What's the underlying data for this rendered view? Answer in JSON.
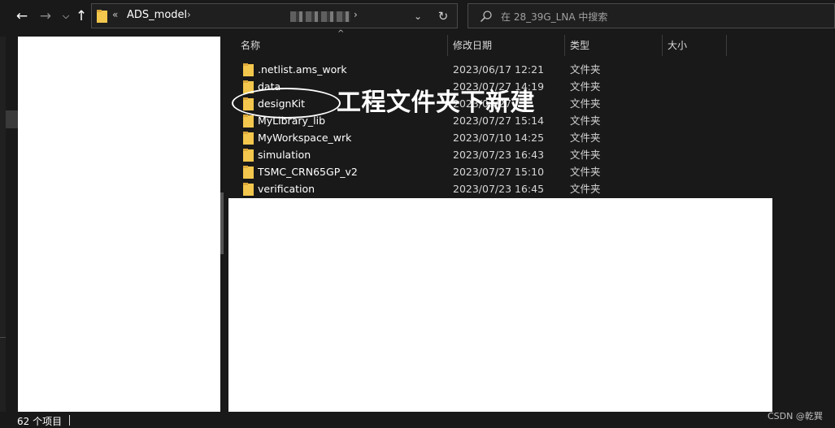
{
  "toolbar": {
    "back_icon": "back-arrow-icon",
    "forward_icon": "forward-arrow-icon",
    "recent_icon": "chevron-down-icon",
    "up_icon": "up-arrow-icon"
  },
  "address": {
    "overflow": "«",
    "crumb": "ADS_model",
    "crumb_sep": "›",
    "end_sep": "›",
    "dropdown": "⌄",
    "refresh": "↻"
  },
  "search": {
    "placeholder": "在 28_39G_LNA 中搜索"
  },
  "columns": {
    "name": "名称",
    "date": "修改日期",
    "type": "类型",
    "size": "大小",
    "sort_indicator": "^"
  },
  "files": [
    {
      "name": ".netlist.ams_work",
      "date": "2023/06/17 12:21",
      "type": "文件夹"
    },
    {
      "name": "data",
      "date": "2023/07/27 14:19",
      "type": "文件夹"
    },
    {
      "name": "designKit",
      "date": "2023/07/27",
      "type": "文件夹"
    },
    {
      "name": "MyLibrary_lib",
      "date": "2023/07/27 15:14",
      "type": "文件夹"
    },
    {
      "name": "MyWorkspace_wrk",
      "date": "2023/07/10 14:25",
      "type": "文件夹"
    },
    {
      "name": "simulation",
      "date": "2023/07/23 16:43",
      "type": "文件夹"
    },
    {
      "name": "TSMC_CRN65GP_v2",
      "date": "2023/07/27 15:10",
      "type": "文件夹"
    },
    {
      "name": "verification",
      "date": "2023/07/23 16:45",
      "type": "文件夹"
    }
  ],
  "annotation": {
    "text": "工程文件夹下新建"
  },
  "status": {
    "count": "62 个项目"
  },
  "watermark": "CSDN @乾巽",
  "colors": {
    "background": "#191919",
    "folder": "#f3c74d",
    "annotation": "#ffffff"
  }
}
